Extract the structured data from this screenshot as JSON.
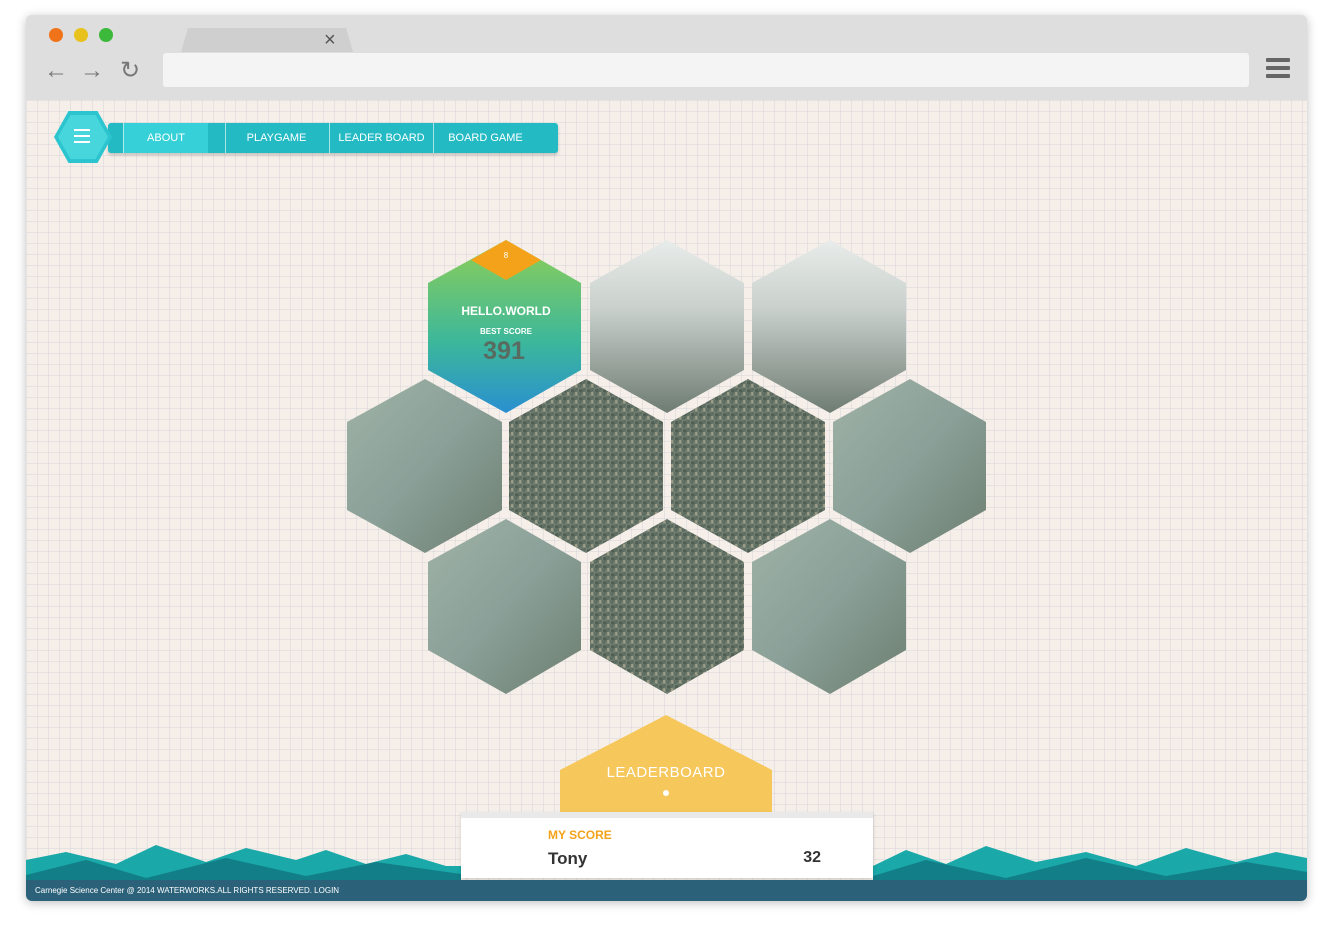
{
  "browser": {
    "tab_close": "×",
    "back": "←",
    "forward": "→",
    "reload": "↻"
  },
  "nav": {
    "items": [
      {
        "label": "ABOUT"
      },
      {
        "label": "PLAYGAME"
      },
      {
        "label": "LEADER BOARD"
      },
      {
        "label": "BOARD GAME"
      }
    ],
    "active_index": 0
  },
  "player_tile": {
    "badge": "8",
    "username": "HELLO.WORLD",
    "best_score_label": "BEST SCORE",
    "best_score": "391"
  },
  "leaderboard": {
    "title": "LEADERBOARD",
    "my_score_label": "MY SCORE",
    "name": "Tony",
    "score": "32"
  },
  "footer": {
    "text": "Carnegie Science Center @ 2014 WATERWORKS.ALL RIGHTS RESERVED. LOGIN"
  },
  "colors": {
    "accent": "#23bac4",
    "leader": "#f6c75b",
    "badge": "#f4a21a",
    "footer": "#2b627a"
  }
}
